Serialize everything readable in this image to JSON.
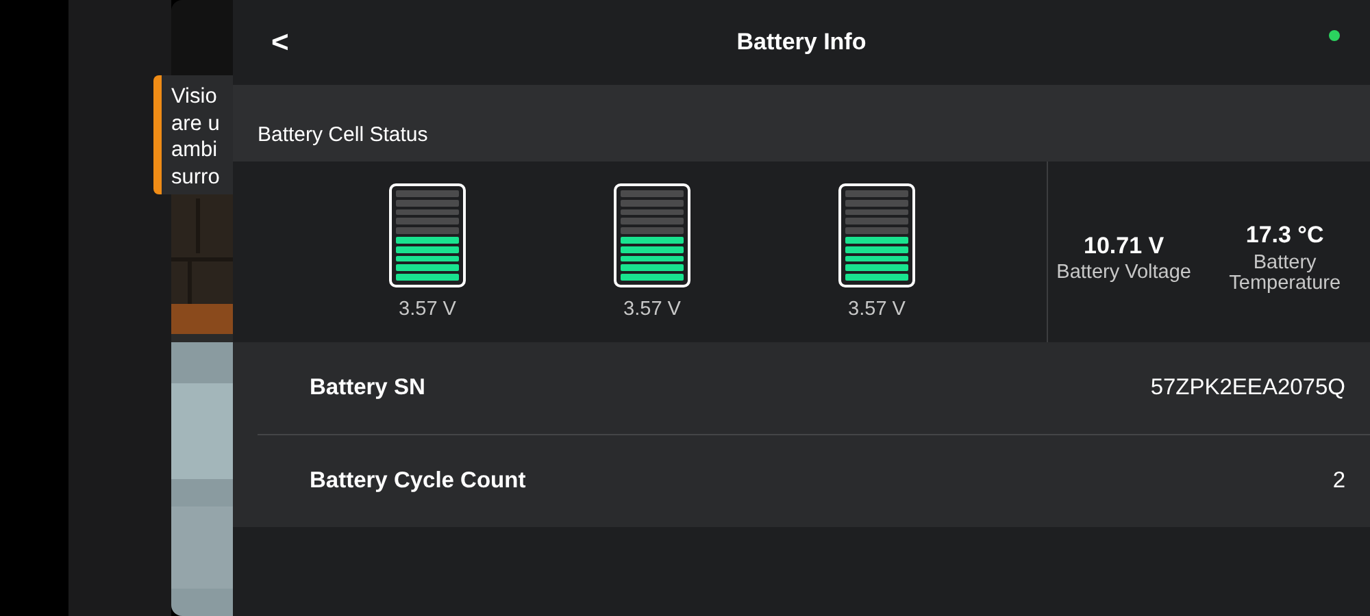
{
  "warning": {
    "lines": [
      "Visio",
      "are u",
      "ambi",
      "surro"
    ]
  },
  "header": {
    "back": "<",
    "title": "Battery Info",
    "connected": true
  },
  "cell_status": {
    "title": "Battery Cell Status",
    "cells": [
      {
        "level": 0.5,
        "reading": "3.57 V"
      },
      {
        "level": 0.5,
        "reading": "3.57 V"
      },
      {
        "level": 0.5,
        "reading": "3.57 V"
      }
    ],
    "stats": [
      {
        "value": "10.71 V",
        "label": "Battery Voltage"
      },
      {
        "value": "17.3 °C",
        "label": "Battery Temperature"
      }
    ]
  },
  "details": [
    {
      "label": "Battery SN",
      "value": "57ZPK2EEA2075Q"
    },
    {
      "label": "Battery Cycle Count",
      "value": "2"
    }
  ]
}
